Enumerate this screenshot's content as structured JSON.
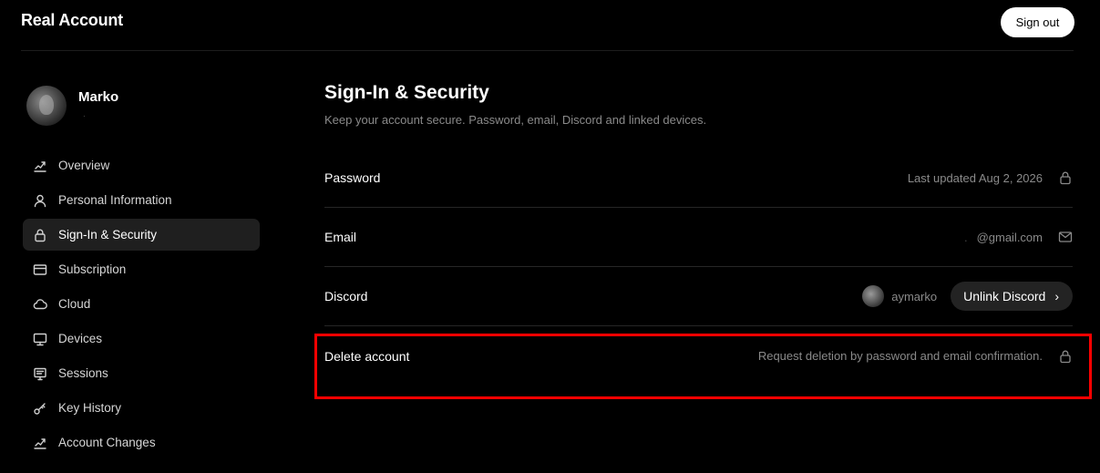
{
  "header": {
    "app_title": "Real Account",
    "signout_label": "Sign out"
  },
  "profile": {
    "name": "Marko",
    "subtitle": "."
  },
  "sidebar": {
    "items": [
      {
        "label": "Overview",
        "icon": "chart-icon",
        "active": false
      },
      {
        "label": "Personal Information",
        "icon": "user-icon",
        "active": false
      },
      {
        "label": "Sign-In & Security",
        "icon": "lock-icon",
        "active": true
      },
      {
        "label": "Subscription",
        "icon": "card-icon",
        "active": false
      },
      {
        "label": "Cloud",
        "icon": "cloud-icon",
        "active": false
      },
      {
        "label": "Devices",
        "icon": "monitor-icon",
        "active": false
      },
      {
        "label": "Sessions",
        "icon": "sessions-icon",
        "active": false
      },
      {
        "label": "Key History",
        "icon": "key-icon",
        "active": false
      },
      {
        "label": "Account Changes",
        "icon": "chart-icon",
        "active": false
      }
    ]
  },
  "main": {
    "title": "Sign-In & Security",
    "description": "Keep your account secure. Password, email, Discord and linked devices.",
    "rows": {
      "password": {
        "label": "Password",
        "value": "Last updated Aug 2, 2026",
        "icon": "lock-icon"
      },
      "email": {
        "label": "Email",
        "value_prefix": ".",
        "value": "@gmail.com",
        "icon": "mail-icon"
      },
      "discord": {
        "label": "Discord",
        "username": "aymarko",
        "button_label": "Unlink Discord",
        "button_icon": "chevron-right-icon"
      },
      "delete": {
        "label": "Delete account",
        "value": "Request deletion by password and email confirmation.",
        "icon": "lock-icon"
      }
    }
  },
  "colors": {
    "background": "#000000",
    "active_nav": "#1f1f1f",
    "muted_text": "#8a8a8a",
    "highlight": "#ff0000"
  }
}
